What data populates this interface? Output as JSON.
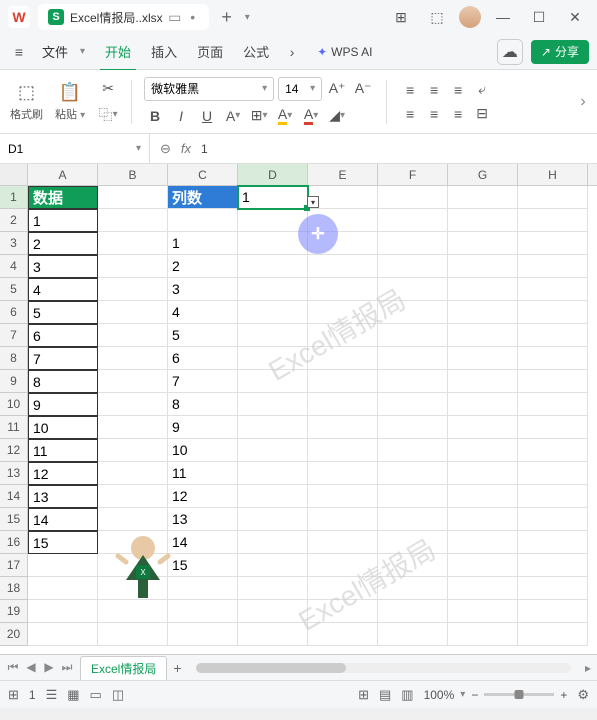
{
  "titlebar": {
    "app_icon_letter": "W",
    "file_icon_letter": "S",
    "filename": "Excel情报局..xlsx",
    "add_tab": "+"
  },
  "menubar": {
    "hamburger": "≡",
    "file": "文件",
    "tabs": [
      "开始",
      "插入",
      "页面",
      "公式"
    ],
    "more": "›",
    "ai_label": "WPS AI",
    "share": "分享"
  },
  "ribbon": {
    "format_brush": "格式刷",
    "paste": "粘贴",
    "font_name": "微软雅黑",
    "font_size": "14",
    "btns": {
      "bold": "B",
      "italic": "I",
      "underline": "U",
      "a_plus": "A⁺",
      "a_minus": "A⁻"
    }
  },
  "formula": {
    "namebox": "D1",
    "fx": "fx",
    "value": "1"
  },
  "columns": [
    "A",
    "B",
    "C",
    "D",
    "E",
    "F",
    "G",
    "H"
  ],
  "rows_n": 20,
  "cells": {
    "A1": "数据",
    "C1": "列数",
    "D1": "1",
    "A": [
      "1",
      "2",
      "3",
      "4",
      "5",
      "6",
      "7",
      "8",
      "9",
      "10",
      "11",
      "12",
      "13",
      "14",
      "15"
    ],
    "C": [
      "1",
      "2",
      "3",
      "4",
      "5",
      "6",
      "7",
      "8",
      "9",
      "10",
      "11",
      "12",
      "13",
      "14",
      "15"
    ]
  },
  "watermark": "Excel情报局",
  "sheetbar": {
    "tab_name": "Excel情报局",
    "add": "+"
  },
  "statusbar": {
    "count": "1",
    "zoom": "100%"
  },
  "chart_data": {
    "type": "table",
    "columns": [
      "数据",
      "列数"
    ],
    "series": [
      {
        "name": "数据",
        "values": [
          1,
          2,
          3,
          4,
          5,
          6,
          7,
          8,
          9,
          10,
          11,
          12,
          13,
          14,
          15
        ]
      },
      {
        "name": "列数",
        "values": [
          1,
          2,
          3,
          4,
          5,
          6,
          7,
          8,
          9,
          10,
          11,
          12,
          13,
          14,
          15
        ]
      }
    ],
    "d1_value": 1
  }
}
